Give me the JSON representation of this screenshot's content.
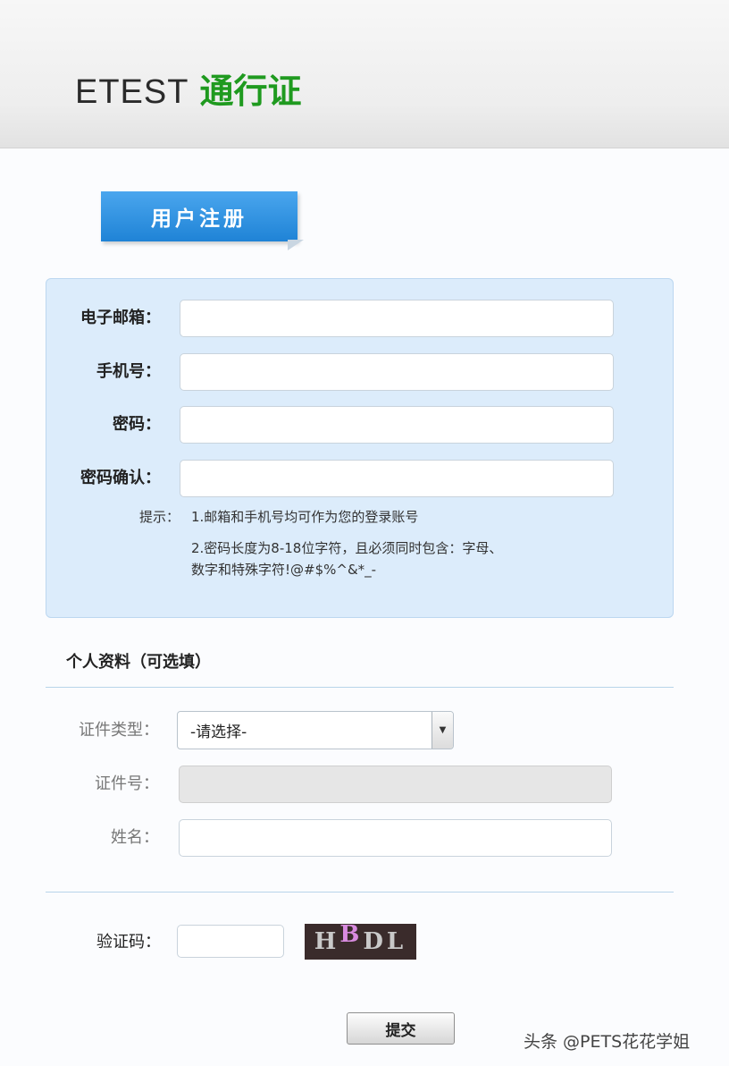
{
  "header": {
    "brand": "ETEST",
    "title": "通行证"
  },
  "register_tab": "用户注册",
  "account": {
    "email_label": "电子邮箱：",
    "phone_label": "手机号：",
    "password_label": "密码：",
    "confirm_label": "密码确认：",
    "tips_prefix": "提示：",
    "tip1": "1.邮箱和手机号均可作为您的登录账号",
    "tip2_line1": "2.密码长度为8-18位字符，且必须同时包含：字母、",
    "tip2_line2": "数字和特殊字符!@#$%^&*_-"
  },
  "profile": {
    "section_title": "个人资料（可选填）",
    "id_type_label": "证件类型：",
    "id_type_selected": "-请选择-",
    "id_number_label": "证件号：",
    "name_label": "姓名："
  },
  "captcha": {
    "label": "验证码：",
    "chars": [
      "H",
      "B",
      "D",
      "L"
    ]
  },
  "submit_label": "提交",
  "watermark": "头条 @PETS花花学姐",
  "icons": {
    "dropdown": "chevron-down-icon"
  }
}
